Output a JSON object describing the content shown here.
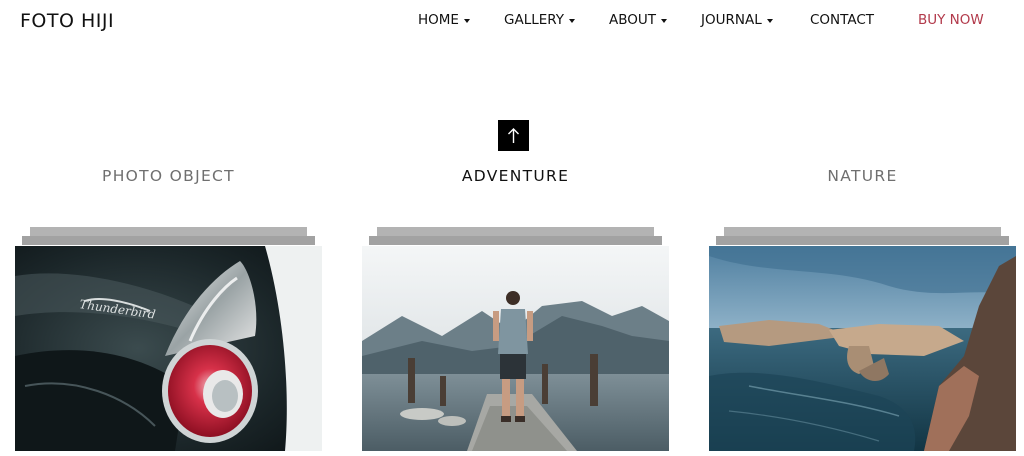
{
  "brand": {
    "logo": "FOTO HIJI"
  },
  "nav": {
    "items": [
      {
        "label": "HOME",
        "dropdown": true
      },
      {
        "label": "GALLERY",
        "dropdown": true
      },
      {
        "label": "ABOUT",
        "dropdown": true
      },
      {
        "label": "JOURNAL",
        "dropdown": true
      },
      {
        "label": "CONTACT",
        "dropdown": false
      }
    ],
    "cta": {
      "label": "BUY NOW",
      "color": "#b23a4b"
    }
  },
  "scroll_top_icon": "arrow-up-icon",
  "categories": [
    {
      "title": "PHOTO OBJECT",
      "active": false,
      "image": "car-tail-light-photo"
    },
    {
      "title": "ADVENTURE",
      "active": true,
      "image": "man-on-pier-photo"
    },
    {
      "title": "NATURE",
      "active": false,
      "image": "coastal-cliffs-photo"
    }
  ]
}
